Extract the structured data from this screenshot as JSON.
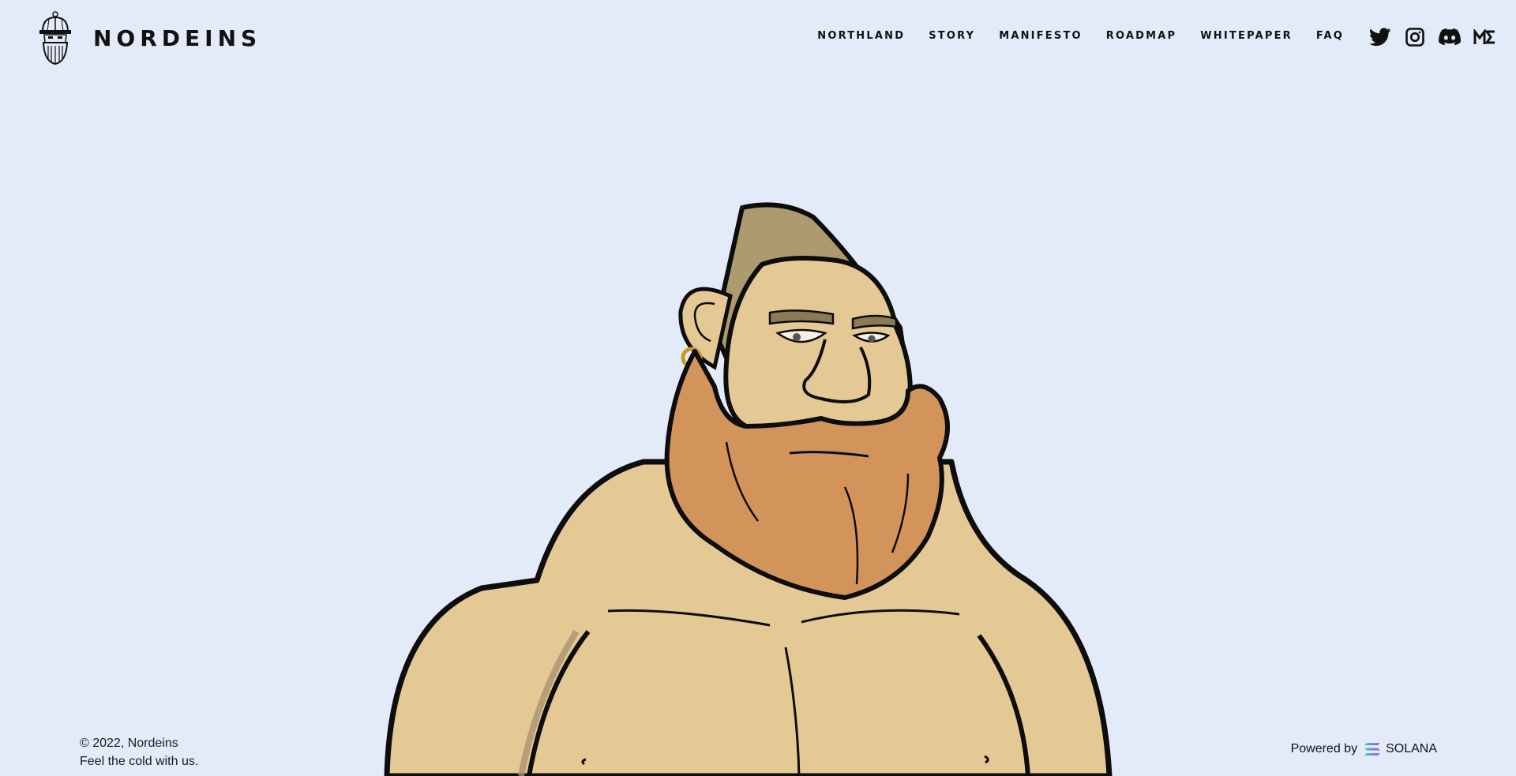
{
  "brand": {
    "name": "NORDEINS"
  },
  "nav": {
    "items": [
      {
        "label": "NORTHLAND"
      },
      {
        "label": "STORY"
      },
      {
        "label": "MANIFESTO"
      },
      {
        "label": "ROADMAP"
      },
      {
        "label": "WHITEPAPER"
      },
      {
        "label": "FAQ"
      }
    ]
  },
  "socials": [
    "twitter-icon",
    "instagram-icon",
    "discord-icon",
    "magic-eden-icon"
  ],
  "hero": {
    "image": "bearded-viking-character-illustration"
  },
  "footer": {
    "copyright": "© 2022, Nordeins",
    "tagline": "Feel the cold with us.",
    "powered_by": "Powered by",
    "powered_name": "SOLANA"
  },
  "colors": {
    "background": "#e4ebf8",
    "skin": "#e4c994",
    "beard": "#d2945a",
    "hair": "#ad9a6e",
    "outline": "#0d0d0d"
  }
}
